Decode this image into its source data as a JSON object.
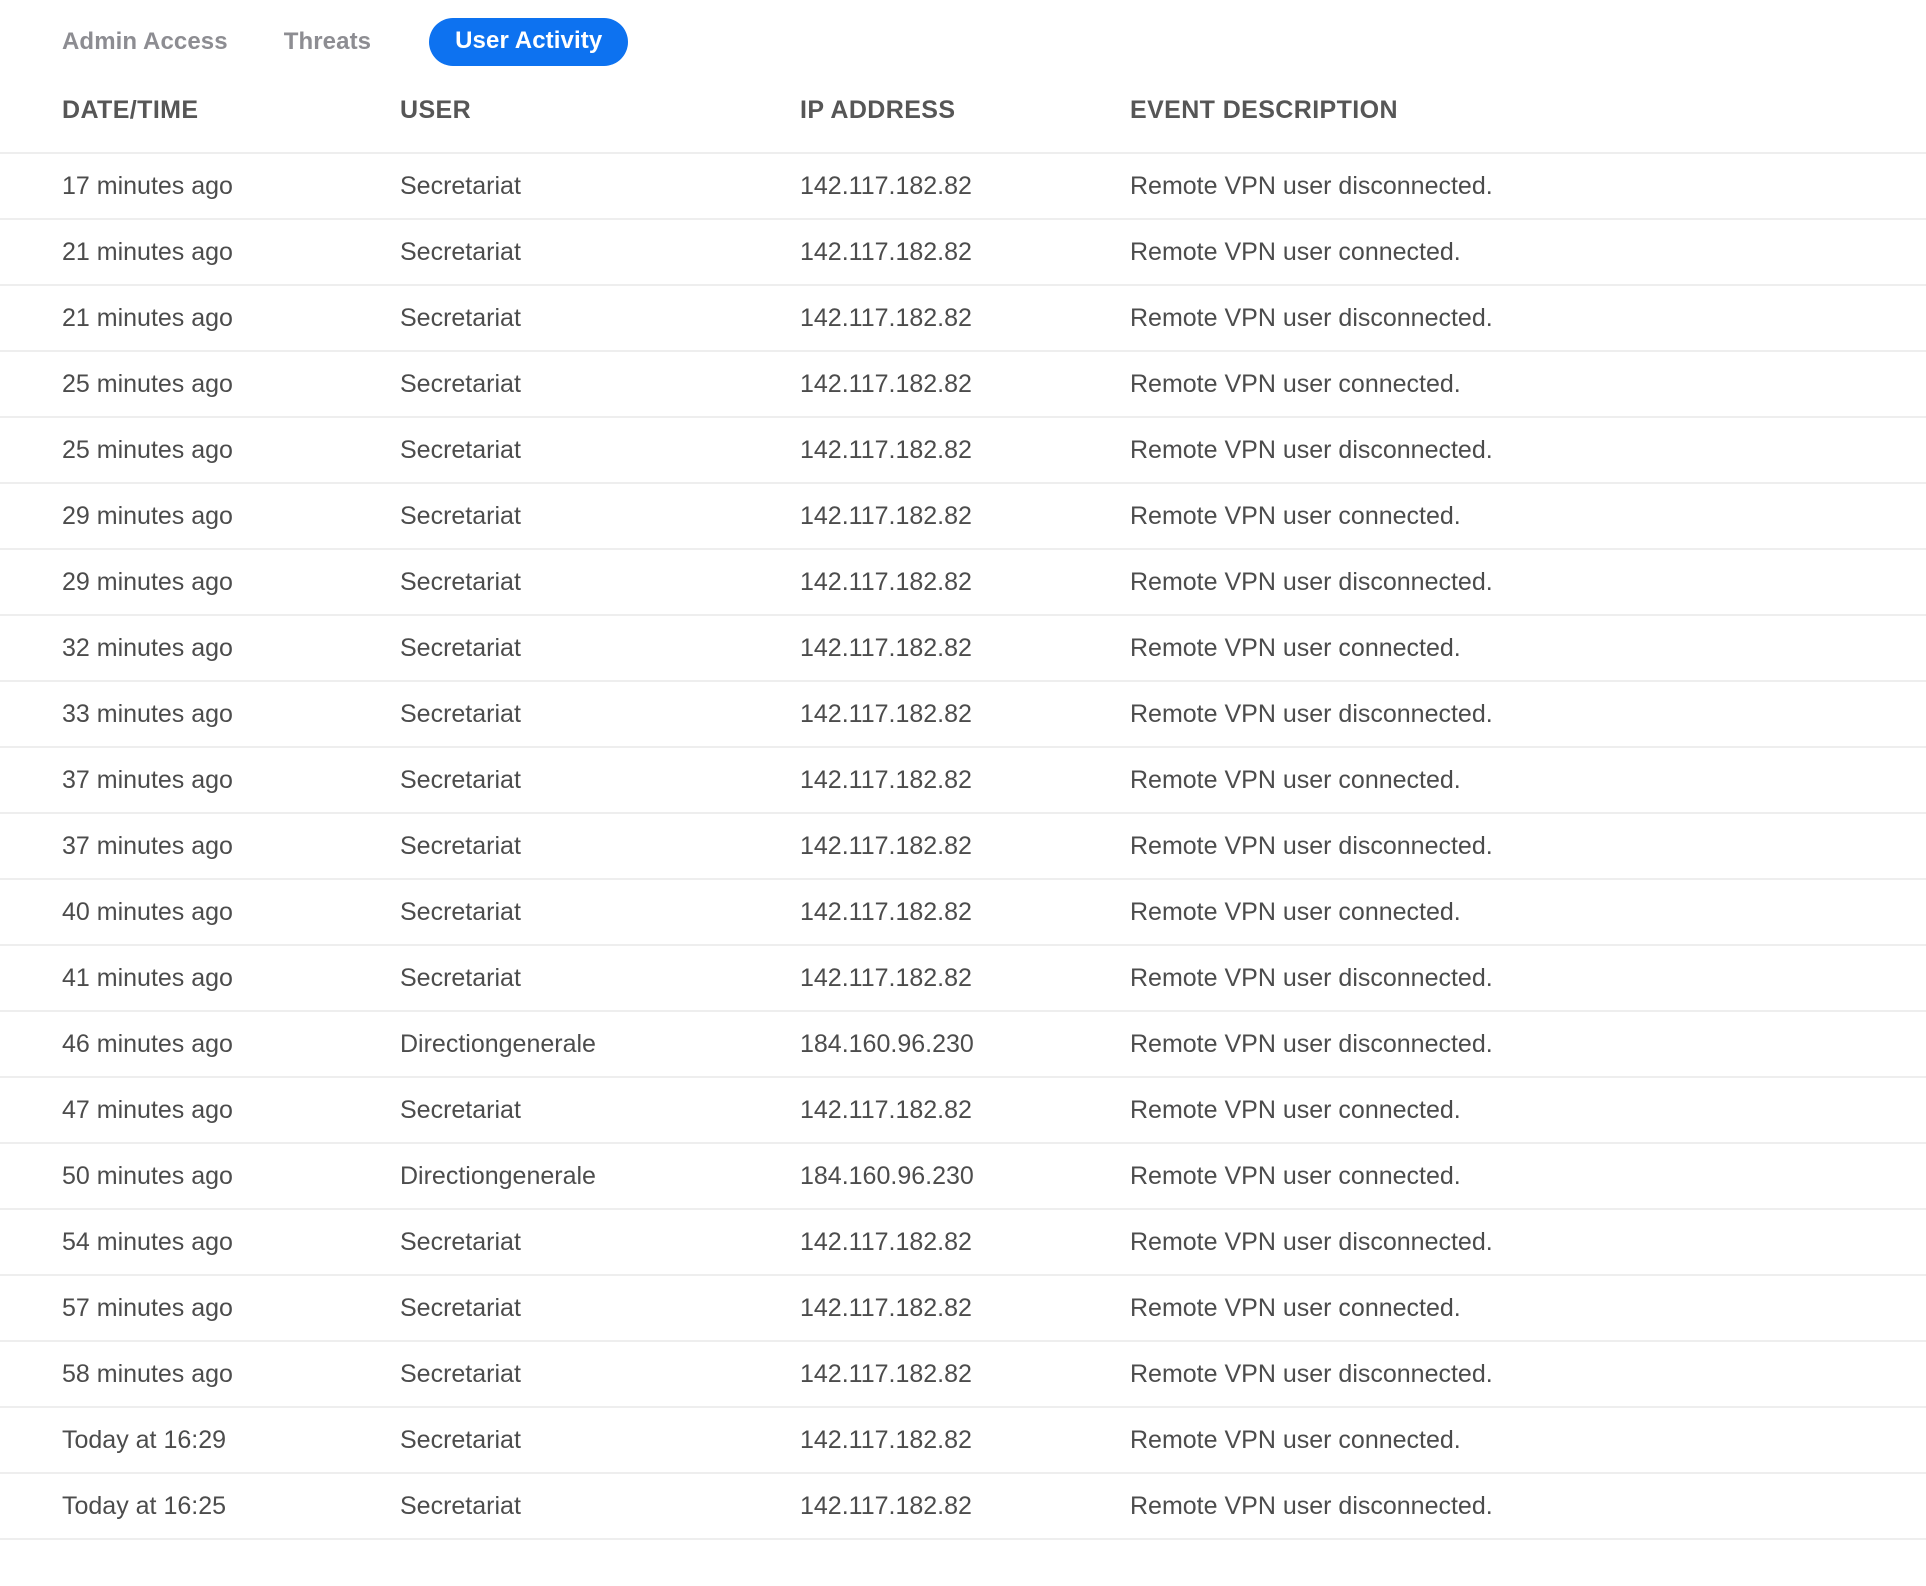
{
  "tabs": [
    {
      "label": "Admin Access",
      "active": false
    },
    {
      "label": "Threats",
      "active": false
    },
    {
      "label": "User Activity",
      "active": true
    }
  ],
  "accent_color": "#0d72f0",
  "table": {
    "columns": [
      "DATE/TIME",
      "USER",
      "IP ADDRESS",
      "EVENT DESCRIPTION"
    ],
    "rows": [
      {
        "datetime": "17 minutes ago",
        "user": "Secretariat",
        "ip": "142.117.182.82",
        "event": "Remote VPN user disconnected."
      },
      {
        "datetime": "21 minutes ago",
        "user": "Secretariat",
        "ip": "142.117.182.82",
        "event": "Remote VPN user connected."
      },
      {
        "datetime": "21 minutes ago",
        "user": "Secretariat",
        "ip": "142.117.182.82",
        "event": "Remote VPN user disconnected."
      },
      {
        "datetime": "25 minutes ago",
        "user": "Secretariat",
        "ip": "142.117.182.82",
        "event": "Remote VPN user connected."
      },
      {
        "datetime": "25 minutes ago",
        "user": "Secretariat",
        "ip": "142.117.182.82",
        "event": "Remote VPN user disconnected."
      },
      {
        "datetime": "29 minutes ago",
        "user": "Secretariat",
        "ip": "142.117.182.82",
        "event": "Remote VPN user connected."
      },
      {
        "datetime": "29 minutes ago",
        "user": "Secretariat",
        "ip": "142.117.182.82",
        "event": "Remote VPN user disconnected."
      },
      {
        "datetime": "32 minutes ago",
        "user": "Secretariat",
        "ip": "142.117.182.82",
        "event": "Remote VPN user connected."
      },
      {
        "datetime": "33 minutes ago",
        "user": "Secretariat",
        "ip": "142.117.182.82",
        "event": "Remote VPN user disconnected."
      },
      {
        "datetime": "37 minutes ago",
        "user": "Secretariat",
        "ip": "142.117.182.82",
        "event": "Remote VPN user connected."
      },
      {
        "datetime": "37 minutes ago",
        "user": "Secretariat",
        "ip": "142.117.182.82",
        "event": "Remote VPN user disconnected."
      },
      {
        "datetime": "40 minutes ago",
        "user": "Secretariat",
        "ip": "142.117.182.82",
        "event": "Remote VPN user connected."
      },
      {
        "datetime": "41 minutes ago",
        "user": "Secretariat",
        "ip": "142.117.182.82",
        "event": "Remote VPN user disconnected."
      },
      {
        "datetime": "46 minutes ago",
        "user": "Directiongenerale",
        "ip": "184.160.96.230",
        "event": "Remote VPN user disconnected."
      },
      {
        "datetime": "47 minutes ago",
        "user": "Secretariat",
        "ip": "142.117.182.82",
        "event": "Remote VPN user connected."
      },
      {
        "datetime": "50 minutes ago",
        "user": "Directiongenerale",
        "ip": "184.160.96.230",
        "event": "Remote VPN user connected."
      },
      {
        "datetime": "54 minutes ago",
        "user": "Secretariat",
        "ip": "142.117.182.82",
        "event": "Remote VPN user disconnected."
      },
      {
        "datetime": "57 minutes ago",
        "user": "Secretariat",
        "ip": "142.117.182.82",
        "event": "Remote VPN user connected."
      },
      {
        "datetime": "58 minutes ago",
        "user": "Secretariat",
        "ip": "142.117.182.82",
        "event": "Remote VPN user disconnected."
      },
      {
        "datetime": "Today at 16:29",
        "user": "Secretariat",
        "ip": "142.117.182.82",
        "event": "Remote VPN user connected."
      },
      {
        "datetime": "Today at 16:25",
        "user": "Secretariat",
        "ip": "142.117.182.82",
        "event": "Remote VPN user disconnected."
      }
    ]
  }
}
